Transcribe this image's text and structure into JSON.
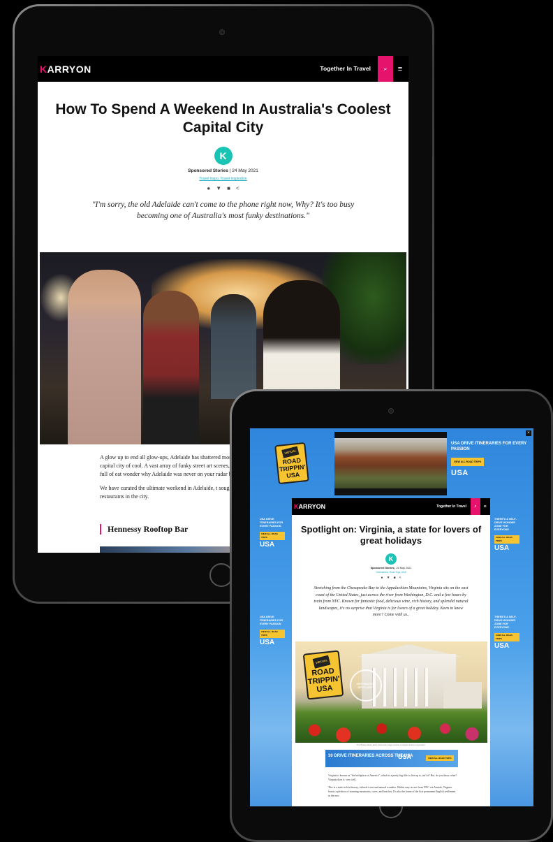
{
  "tablet1": {
    "header": {
      "logo_k": "K",
      "logo_rest": "ARRYON",
      "tagline": "Together In Travel",
      "search_icon": "⌕",
      "menu_icon": "≡"
    },
    "article": {
      "title": "How To Spend A Weekend In Australia's Coolest Capital City",
      "avatar_letter": "K",
      "author": "Sponsored Stories",
      "date": "| 24 May 2021",
      "tags": "Travel Inspo, Travel Inspiration",
      "share_icons": [
        "facebook-icon",
        "twitter-icon",
        "linkedin-icon",
        "share-icon"
      ],
      "quote": "\"I'm sorry, the old Adelaide can't come to the phone right now, Why? It's too busy becoming one of Australia's most funky destinations.\"",
      "body": [
        "A glow up to end all glow-ups, Adelaide has shattered morphed into the capital city of cool. A vast array of funky street art scenes, and little laneways full of eat wonder why Adelaide was never on your radar befor",
        "We have curated the ultimate weekend in Adelaide, t sought-after bars and restaurants in the city."
      ],
      "section_heading": "Hennessy Rooftop Bar"
    }
  },
  "tablet2": {
    "close_label": "×",
    "ad_top": {
      "road_sign_ribbon": "VIRTUAL",
      "road_sign_text": "ROAD TRIPPIN' USA",
      "promo_title": "USA DRIVE ITINERARIES FOR EVERY PASSION",
      "promo_button": "VIEW ALL ROAD TRIPS",
      "brand": "USA"
    },
    "side_left": {
      "text": "USA DRIVE ITINERARIES FOR EVERY PASSION",
      "button": "VIEW ALL ROAD TRIPS",
      "brand": "USA"
    },
    "side_right": {
      "text": "THERE'S A SELF-DRIVE WONDER ZONE FOR EVERYONE",
      "button": "VIEW ALL ROAD TRIPS",
      "brand": "USA"
    },
    "header": {
      "logo_k": "K",
      "logo_rest": "ARRYON",
      "tagline": "Together In Travel",
      "search_icon": "⌕",
      "menu_icon": "≡"
    },
    "article": {
      "title": "Spotlight on: Virginia, a state for lovers of great holidays",
      "avatar_letter": "K",
      "author": "Sponsored Stories",
      "date": "| 24 May 2021",
      "tags": "Destinations, Road Trips, USA",
      "quote": "Stretching from the Chesapeake Bay to the Appalachian Mountains, Virginia sits on the east coast of the United States, just across the river from Washington, D.C. and a few hours by train from NYC. Known for fantastic food, delicious wine, rich history, and splendid natural landscapes, it's no surprise that Virginia is for lovers of a great holiday. Keen to know more? Come with us..",
      "hero_sign_ribbon": "VIRTUAL",
      "hero_sign_text": "ROAD TRIPPIN' USA",
      "seal_text": "DESTINATION SPOTLIGHT",
      "caption": "The Virginia State Capitol, Richmond. Image courtesy of Virginia Tourism Corporation.",
      "banner_text": "30 DRIVE ITINERARIES ACROSS THE USA",
      "banner_brand": "USA",
      "banner_button": "VIEW ALL ROAD TRIPS",
      "body": [
        "Virginia is known as \"the birthplace of America\", which is a pretty big title to live up to, isn't it? But, do you know what? Virginia does it, very well.",
        "This is a state rich in history, cultural icons and natural wonders. Within easy access from NYC via Amtrak, Virginia boasts a plethora of stunning mountains, caves, and beaches. It's also the home of the first permanent English settlement in the new"
      ]
    }
  },
  "colors": {
    "brand_pink": "#e6136d",
    "teal_avatar": "#19c4b4",
    "ad_blue": "#3a8fe0",
    "ad_yellow": "#f5c430"
  }
}
